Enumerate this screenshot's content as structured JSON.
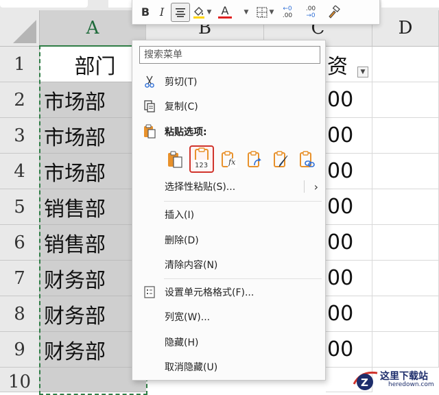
{
  "sheet": {
    "columns": [
      "A",
      "B",
      "C",
      "D"
    ],
    "rows": [
      "1",
      "2",
      "3",
      "4",
      "5",
      "6",
      "7",
      "8",
      "9",
      "10"
    ],
    "col_a": [
      "部门",
      "市场部",
      "市场部",
      "市场部",
      "销售部",
      "销售部",
      "财务部",
      "财务部",
      "财务部"
    ],
    "c1_partial": "资",
    "c_partial": [
      "00",
      "00",
      "00",
      "00",
      "00",
      "00",
      "00",
      "00"
    ],
    "filter_glyph": "▼"
  },
  "minitoolbar": {
    "bold": "B",
    "italic": "I",
    "font_color_letter": "A",
    "dec_inc_top": "←0",
    "dec_inc_bot": ".00",
    "dec_dec_top": ".00",
    "dec_dec_bot": "→0",
    "fill_color": "#ffd400",
    "font_color": "#e02020"
  },
  "menu": {
    "search_placeholder": "搜索菜单",
    "cut": "剪切(T)",
    "copy": "复制(C)",
    "paste_options": "粘贴选项:",
    "paste_values_badge": "123",
    "paste_formula_badge": "fx",
    "paste_special": "选择性粘贴(S)...",
    "insert": "插入(I)",
    "delete": "删除(D)",
    "clear": "清除内容(N)",
    "format_cells": "设置单元格格式(F)...",
    "col_width": "列宽(W)...",
    "hide": "隐藏(H)",
    "unhide": "取消隐藏(U)",
    "chevron": "›"
  },
  "watermark": {
    "text": "这里下载站",
    "url": "heredown.com"
  },
  "colors": {
    "selection_green": "#2e7d45",
    "highlight_red": "#d0342c",
    "clipboard_orange": "#e8912b",
    "icon_blue": "#2f6fd6"
  }
}
